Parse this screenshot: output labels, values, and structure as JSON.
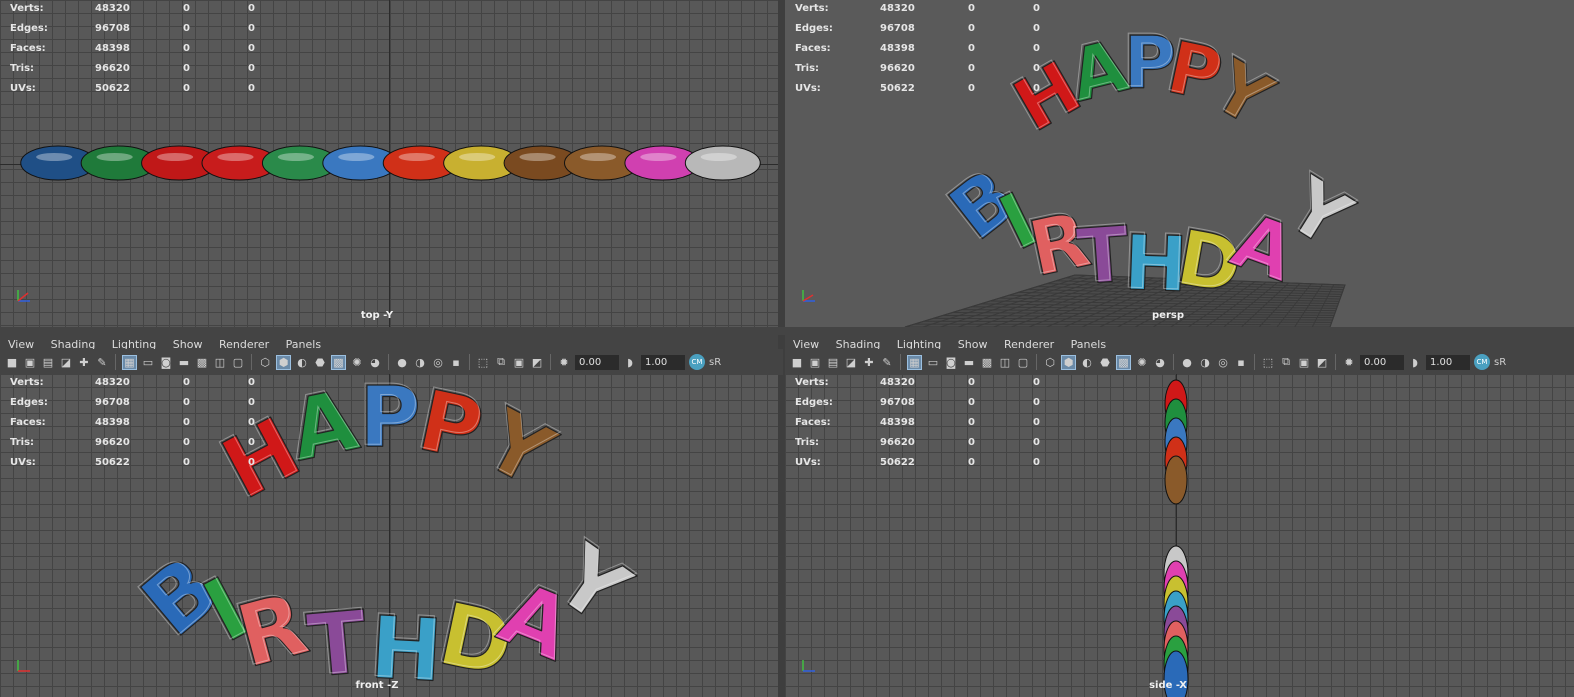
{
  "hud": {
    "labels": [
      "Verts:",
      "Edges:",
      "Faces:",
      "Tris:",
      "UVs:"
    ],
    "values": [
      "48320",
      "96708",
      "48398",
      "96620",
      "50622"
    ],
    "zero": "0"
  },
  "viewports": {
    "top": {
      "camera": "top -Y"
    },
    "persp": {
      "camera": "persp"
    },
    "front": {
      "camera": "front -Z"
    },
    "side": {
      "camera": "side -X"
    }
  },
  "panel_menu": [
    "View",
    "Shading",
    "Lighting",
    "Show",
    "Renderer",
    "Panels"
  ],
  "toolbar": {
    "exposure": "0.00",
    "gamma": "1.00",
    "color_space": "sR",
    "badge": "CM"
  },
  "balloons": {
    "happy": [
      "H",
      "A",
      "P",
      "P",
      "Y"
    ],
    "birthday": [
      "B",
      "I",
      "R",
      "T",
      "H",
      "D",
      "A",
      "Y"
    ],
    "happy_colors": [
      "#d01818",
      "#1f8f3e",
      "#3a78c0",
      "#d03018",
      "#8a5a2a"
    ],
    "birthday_colors": [
      "#2a6ab8",
      "#2aa040",
      "#e06060",
      "#8a4a98",
      "#3aa0c8",
      "#c8c030",
      "#e040b0",
      "#c8c8c8"
    ]
  },
  "top_strip_colors": [
    "#1f4f86",
    "#1f7a3a",
    "#c01818",
    "#c81c1c",
    "#2a8a4a",
    "#3a78c0",
    "#d03018",
    "#c8b030",
    "#7a4a20",
    "#8a5a2a",
    "#d040b0",
    "#b8b8b8"
  ]
}
